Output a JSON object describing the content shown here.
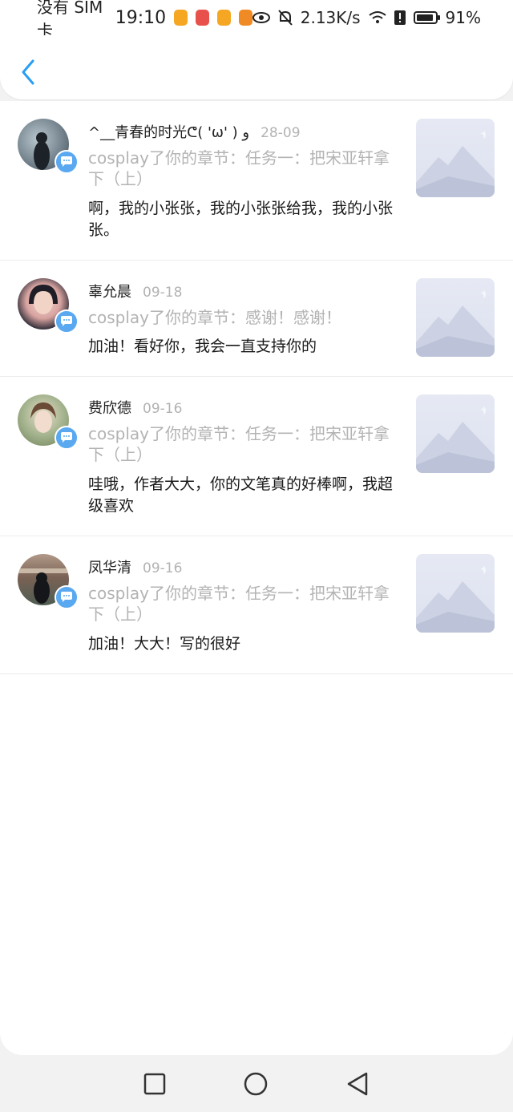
{
  "status_bar": {
    "carrier": "没有 SIM 卡",
    "time": "19:10",
    "net_speed": "2.13K/s",
    "battery": "91%",
    "app_icons": [
      {
        "name": "weibo-icon",
        "color": "#f5a623"
      },
      {
        "name": "huawei-store-icon",
        "color": "#e8514b"
      },
      {
        "name": "weibo-icon",
        "color": "#f5a623"
      },
      {
        "name": "video-app-icon",
        "color": "#f08a24"
      }
    ]
  },
  "header": {
    "back_icon": "chevron-left-icon",
    "accent_color": "#2a9df4"
  },
  "comments": [
    {
      "name": "^__青春的时光ᕦ( 'ω' ) و",
      "date": "28-09",
      "quote": "cosplay了你的章节：任务一：把宋亚轩拿下（上）",
      "reply": "啊，我的小张张，我的小张张给我，我的小张张。"
    },
    {
      "name": "辜允晨",
      "date": "09-18",
      "quote": "cosplay了你的章节：感谢！感谢！",
      "reply": "加油！看好你，我会一直支持你的"
    },
    {
      "name": "费欣德",
      "date": "09-16",
      "quote": "cosplay了你的章节：任务一：把宋亚轩拿下（上）",
      "reply": "哇哦，作者大大，你的文笔真的好棒啊，我超级喜欢"
    },
    {
      "name": "凤华清",
      "date": "09-16",
      "quote": "cosplay了你的章节：任务一：把宋亚轩拿下（上）",
      "reply": "加油！大大！写的很好"
    }
  ],
  "nav_bar": {
    "items": [
      "recent-apps-icon",
      "home-icon",
      "back-icon"
    ]
  }
}
